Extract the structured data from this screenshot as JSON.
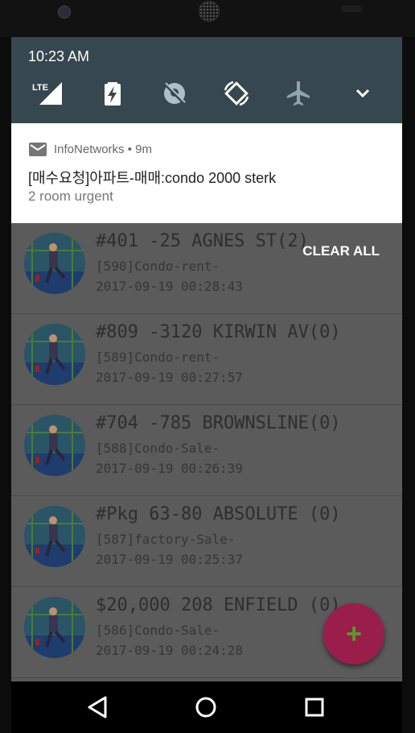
{
  "status": {
    "time": "10:23 AM",
    "lte_label": "LTE"
  },
  "quick_settings": [
    "signal-icon",
    "battery-charging-icon",
    "location-off-icon",
    "auto-rotate-icon",
    "airplane-mode-icon",
    "expand-icon"
  ],
  "notification": {
    "app_name": "InfoNetworks",
    "separator": "•",
    "time_ago": "9m",
    "title": "[매수요청]아파트-매매:condo 2000 sterk",
    "text": "2 room urgent"
  },
  "clear_all": "CLEAR ALL",
  "listings": [
    {
      "title": "#401 -25 AGNES ST(2)",
      "line2": "[590]Condo-rent-",
      "line3": "2017-09-19 00:28:43"
    },
    {
      "title": "#809 -3120 KIRWIN AV(0)",
      "line2": "[589]Condo-rent-",
      "line3": "2017-09-19 00:27:57"
    },
    {
      "title": "#704 -785 BROWNSLINE(0)",
      "line2": "[588]Condo-Sale-",
      "line3": "2017-09-19 00:26:39"
    },
    {
      "title": "#Pkg 63-80 ABSOLUTE (0)",
      "line2": "[587]factory-Sale-",
      "line3": "2017-09-19 00:25:37"
    },
    {
      "title": "$20,000 208 ENFIELD (0)",
      "line2": "[586]Condo-Sale-",
      "line3": "2017-09-19 00:24:28"
    }
  ],
  "fab": {
    "label": "+"
  },
  "colors": {
    "shade": "#37474f",
    "fab": "#9a1e4a",
    "dim_overlay": "#5b5b5b"
  }
}
